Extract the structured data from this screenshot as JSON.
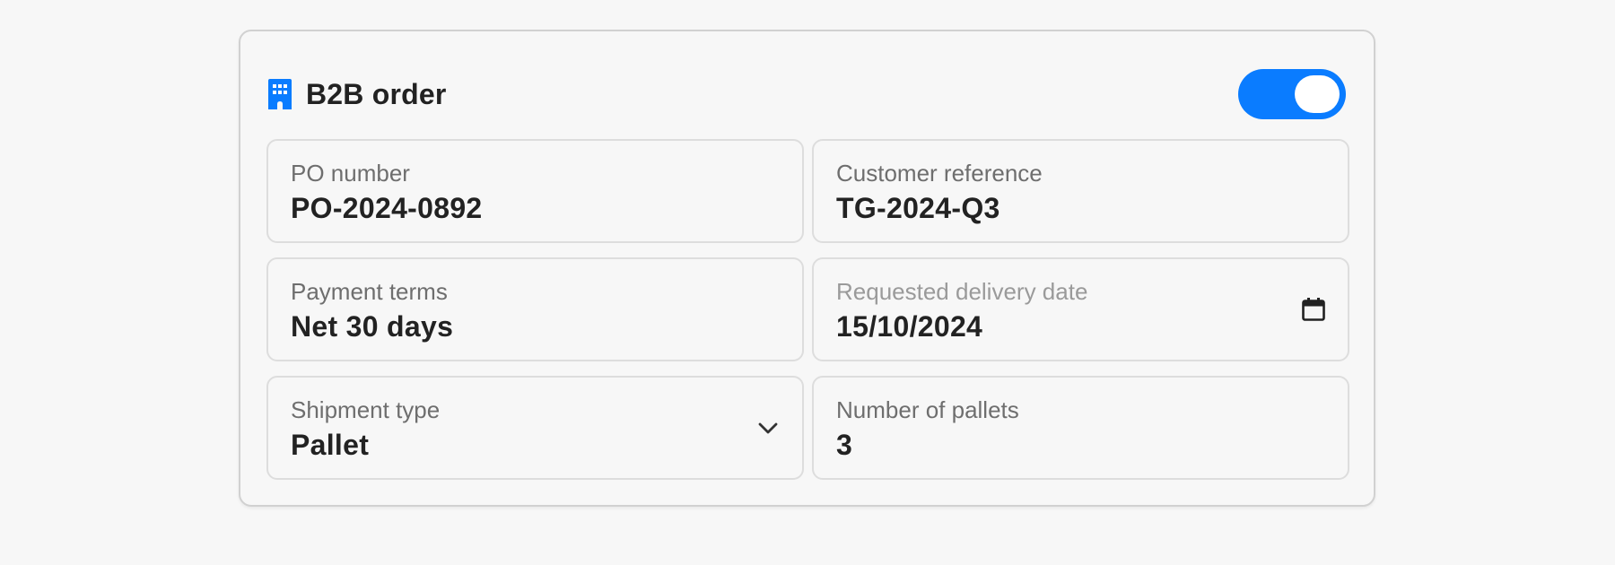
{
  "header": {
    "title": "B2B order",
    "icon": "building-icon",
    "toggle_on": true
  },
  "colors": {
    "accent": "#0a7cff",
    "text": "#222222",
    "label": "#6e6e6e",
    "border": "#dddddd"
  },
  "fields": {
    "po_number": {
      "label": "PO number",
      "value": "PO-2024-0892"
    },
    "customer_reference": {
      "label": "Customer reference",
      "value": "TG-2024-Q3"
    },
    "payment_terms": {
      "label": "Payment terms",
      "value": "Net 30 days"
    },
    "requested_delivery_date": {
      "label": "Requested delivery date",
      "value": "15/10/2024",
      "icon": "calendar-icon"
    },
    "shipment_type": {
      "label": "Shipment type",
      "value": "Pallet",
      "icon": "chevron-down-icon"
    },
    "number_of_pallets": {
      "label": "Number of pallets",
      "value": "3"
    }
  }
}
